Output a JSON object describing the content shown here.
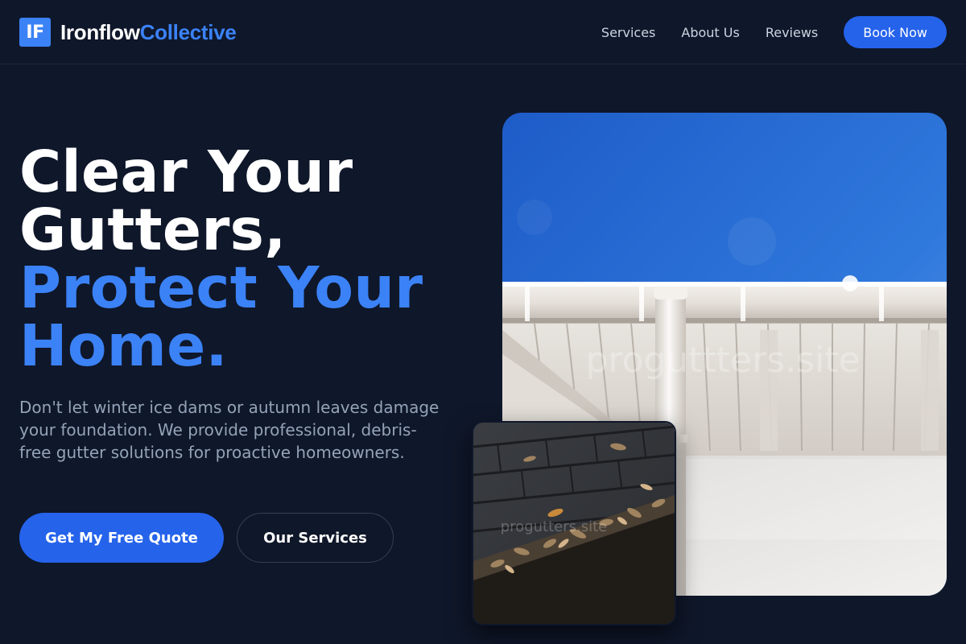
{
  "brand": {
    "mark": "IF",
    "name_primary": "Ironflow",
    "name_accent": "Collective"
  },
  "nav": {
    "items": [
      {
        "label": "Services"
      },
      {
        "label": "About Us"
      },
      {
        "label": "Reviews"
      }
    ],
    "cta_label": "Book Now"
  },
  "hero": {
    "title_line1": "Clear Your",
    "title_line2": "Gutters,",
    "title_line3": "Protect Your",
    "title_line4": "Home.",
    "description": "Don't let winter ice dams or autumn leaves damage your foundation. We provide professional, debris-free gutter solutions for proactive homeowners.",
    "primary_button": "Get My Free Quote",
    "secondary_button": "Our Services"
  },
  "images": {
    "main_watermark": "proguttters.site",
    "small_watermark": "progutters.site"
  },
  "colors": {
    "background": "#0f172a",
    "accent": "#3b82f6",
    "button": "#2563eb",
    "muted_text": "#94a3b8",
    "nav_text": "#cbd5e1"
  }
}
